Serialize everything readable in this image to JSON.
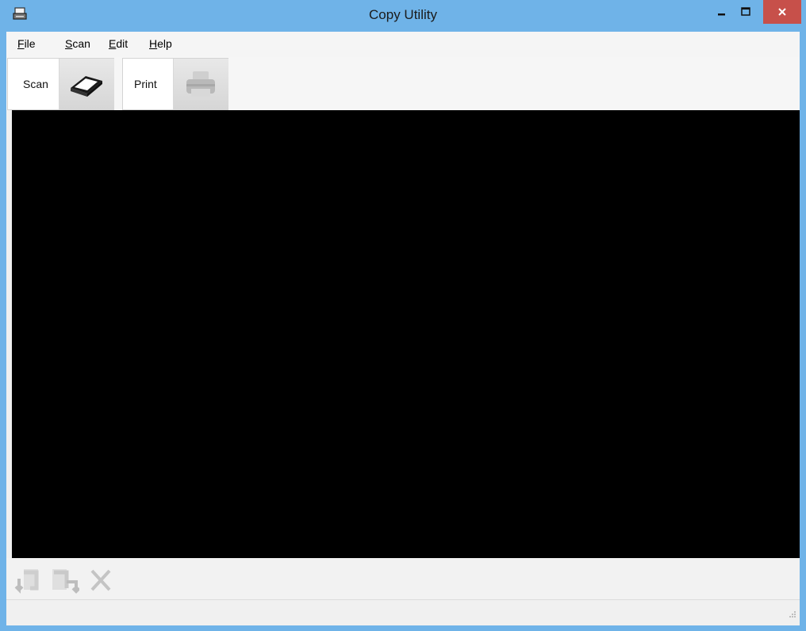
{
  "window": {
    "title": "Copy Utility",
    "icon": "scanner-app-icon",
    "controls": [
      "minimize-icon",
      "maximize-icon",
      "close-icon"
    ],
    "close_color": "#c7504a",
    "frame_color": "#6fb3e8"
  },
  "menu": {
    "items": [
      {
        "label": "File",
        "accel": "F",
        "rest": "ile"
      },
      {
        "label": "Scan",
        "accel": "S",
        "rest": "can"
      },
      {
        "label": "Edit",
        "accel": "E",
        "rest": "dit"
      },
      {
        "label": "Help",
        "accel": "H",
        "rest": "elp"
      }
    ]
  },
  "toolbar": {
    "scan_label": "Scan",
    "scan_icon": "scanner-icon",
    "print_label": "Print",
    "print_icon": "printer-icon"
  },
  "bottom_toolbar": {
    "icons": [
      "rotate-left-icon",
      "rotate-right-icon",
      "delete-icon"
    ]
  },
  "preview": {
    "background": "#000000"
  }
}
